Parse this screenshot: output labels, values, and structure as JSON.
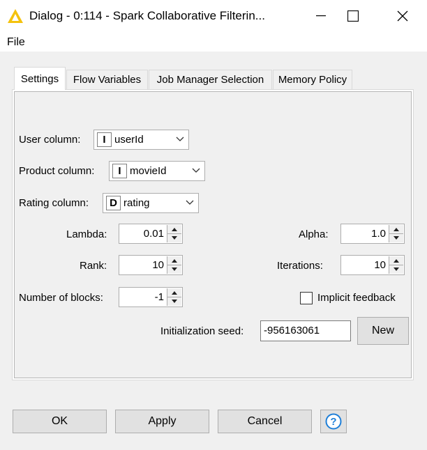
{
  "window": {
    "title": "Dialog - 0:114 - Spark Collaborative Filterin...",
    "icon": "knime-warning-triangle-icon",
    "accent": "#f4c20d"
  },
  "menu": {
    "file": "File"
  },
  "tabs": [
    {
      "label": "Settings",
      "active": true
    },
    {
      "label": "Flow Variables",
      "active": false
    },
    {
      "label": "Job Manager Selection",
      "active": false
    },
    {
      "label": "Memory Policy",
      "active": false
    }
  ],
  "settings": {
    "user_column": {
      "label": "User column:",
      "type": "I",
      "value": "userId"
    },
    "product_column": {
      "label": "Product column:",
      "type": "I",
      "value": "movieId"
    },
    "rating_column": {
      "label": "Rating column:",
      "type": "D",
      "value": "rating"
    },
    "lambda": {
      "label": "Lambda:",
      "value": "0.01"
    },
    "rank": {
      "label": "Rank:",
      "value": "10"
    },
    "blocks": {
      "label": "Number of blocks:",
      "value": "-1"
    },
    "alpha": {
      "label": "Alpha:",
      "value": "1.0"
    },
    "iterations": {
      "label": "Iterations:",
      "value": "10"
    },
    "implicit_feedback": {
      "label": "Implicit feedback",
      "checked": false
    },
    "seed": {
      "label": "Initialization seed:",
      "value": "-956163061",
      "new_button": "New"
    }
  },
  "footer": {
    "ok": "OK",
    "apply": "Apply",
    "cancel": "Cancel",
    "help": "?"
  }
}
